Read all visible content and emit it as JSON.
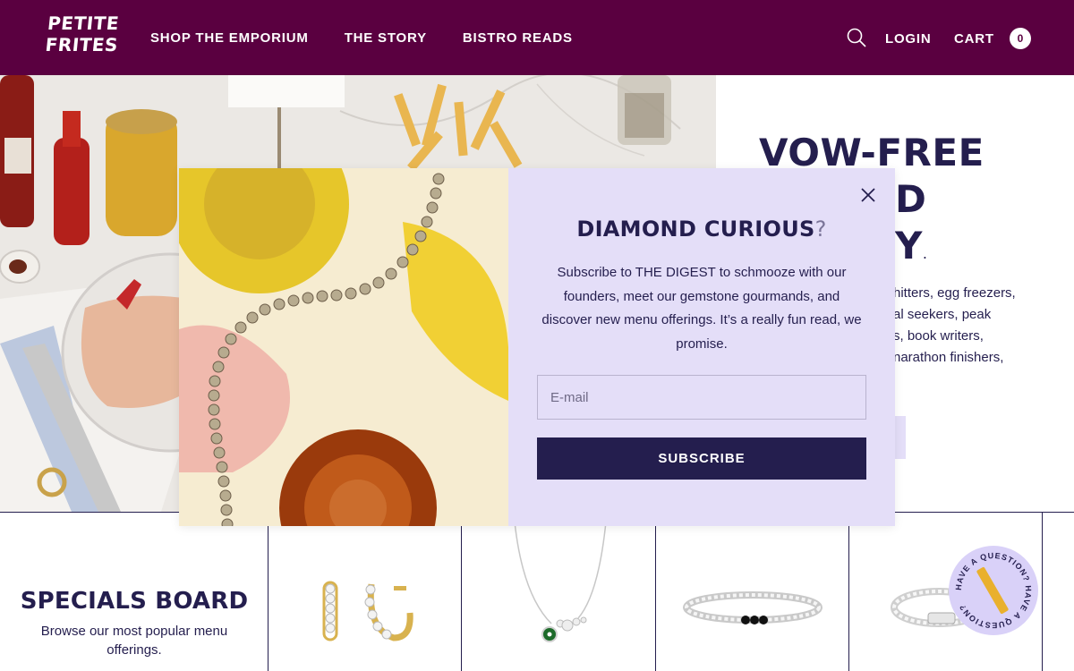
{
  "header": {
    "logo_line1": "PETITE",
    "logo_line2": "FRITES",
    "nav": [
      "SHOP THE EMPORIUM",
      "THE STORY",
      "BISTRO READS"
    ],
    "login": "LOGIN",
    "cart_label": "CART",
    "cart_count": "0"
  },
  "hero": {
    "title_lines": [
      "VOW-FREE",
      "D",
      "Y"
    ],
    "title_period": ".",
    "desc_lines": [
      "hitters, egg freezers,",
      "al seekers, peak",
      "s, book writers,",
      "narathon finishers,"
    ]
  },
  "specials": {
    "title": "SPECIALS BOARD",
    "subtitle": "Browse our most popular menu offerings."
  },
  "help_badge": {
    "text": "HAVE A QUESTION? HAVE A QUESTION?"
  },
  "modal": {
    "title": "DIAMOND CURIOUS",
    "title_mark": "?",
    "text": "Subscribe to THE DIGEST to schmooze with our founders, meet our gemstone gourmands, and discover new menu offerings. It’s a really fun read, we promise.",
    "email_placeholder": "E-mail",
    "subscribe_label": "SUBSCRIBE"
  },
  "colors": {
    "header_bg": "#5a0040",
    "navy": "#241e4e",
    "lavender": "#e4def8"
  }
}
